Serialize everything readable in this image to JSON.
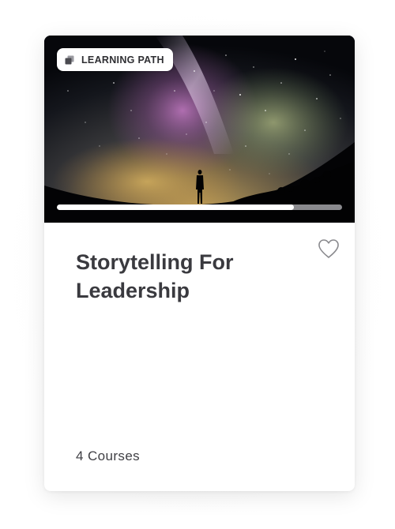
{
  "card": {
    "badge": {
      "label": "LEARNING PATH",
      "icon": "stacked-courses-icon"
    },
    "image": {
      "subject": "starry night sky with milky way and silhouette of person on hill",
      "progress": 0.83
    },
    "title": "Storytelling For Leadership",
    "favorite": {
      "icon": "heart-outline-icon",
      "selected": false
    },
    "course_count": "4 Courses"
  },
  "colors": {
    "title_text": "#3a3a3f",
    "progress_fill": "#ffffff",
    "progress_track": "#8a8a8e",
    "badge_bg": "#ffffff"
  }
}
